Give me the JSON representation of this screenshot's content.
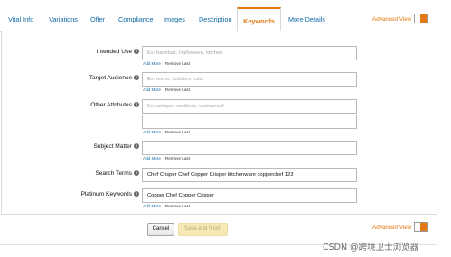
{
  "tabs": [
    {
      "label": "Vital Info",
      "active": false
    },
    {
      "label": "Variations",
      "active": false
    },
    {
      "label": "Offer",
      "active": false
    },
    {
      "label": "Compliance",
      "active": false
    },
    {
      "label": "Images",
      "active": false
    },
    {
      "label": "Description",
      "active": false
    },
    {
      "label": "Keywords",
      "active": true
    },
    {
      "label": "More Details",
      "active": false
    }
  ],
  "advanced_view": {
    "label": "Advanced View",
    "on": true
  },
  "form": {
    "intended_use": {
      "label": "Intended Use",
      "value": "",
      "placeholder": "Ex: baseball, Halloween, kitchen"
    },
    "target_audience": {
      "label": "Target Audience",
      "value": "",
      "placeholder": "Ex: teens, toddlers, cats"
    },
    "other_attributes": {
      "label": "Other Attributes",
      "value": "",
      "placeholder": "Ex: antique, cordless, waterproof",
      "value2": ""
    },
    "subject_matter": {
      "label": "Subject Matter",
      "value": ""
    },
    "search_terms": {
      "label": "Search Terms",
      "value": "Chef Crisper Chef Copper Crisper kitchenware copperchef 123"
    },
    "platinum_keywords": {
      "label": "Platinum Keywords",
      "value": "Copper Chef Copper Crisper"
    },
    "add_more": "Add More",
    "remove_last": "Remove Last"
  },
  "actions": {
    "cancel": "Cancel",
    "save": "Save and finish"
  },
  "watermark": "CSDN @跨境卫士浏览器",
  "colors": {
    "accent": "#e47911",
    "link": "#0f6aa6",
    "save_bg": "#f6e9b8"
  }
}
